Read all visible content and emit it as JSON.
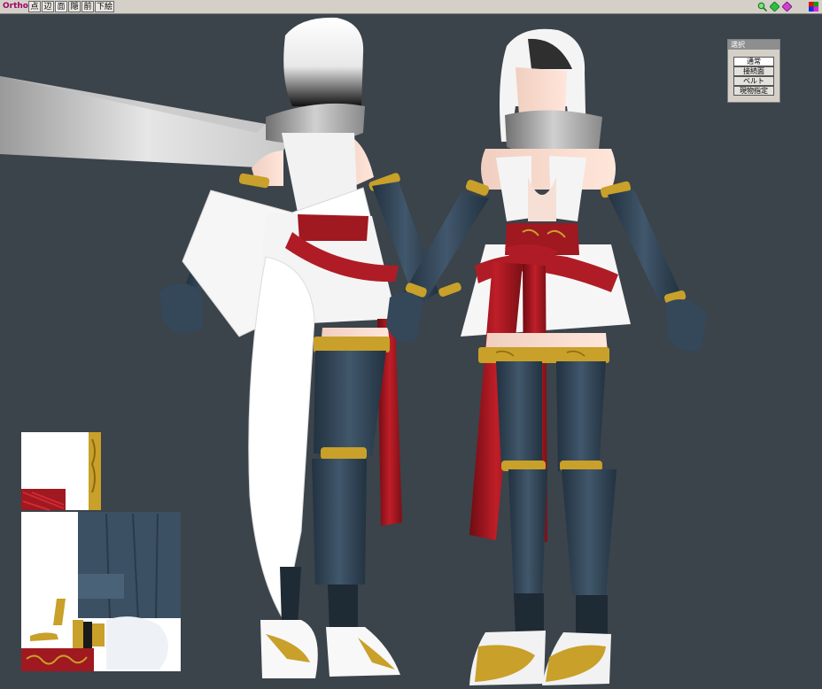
{
  "toolbar": {
    "mode_label": "Ortho",
    "buttons": [
      "点",
      "辺",
      "面",
      "隠",
      "前",
      "下絵"
    ],
    "active_index": 2
  },
  "select_panel": {
    "title": "選択",
    "options": [
      "通常",
      "接続面",
      "ベルト",
      "現物指定"
    ],
    "selected_index": 0
  },
  "colors": {
    "background": "#3b434b",
    "toolbar": "#d4d0c8",
    "outfit_red": "#a01820",
    "outfit_gold": "#c8a02a",
    "outfit_navy": "#34485a"
  },
  "icons": [
    "zoom-icon",
    "move-icon",
    "rotate-icon",
    "color-palette-icon"
  ]
}
